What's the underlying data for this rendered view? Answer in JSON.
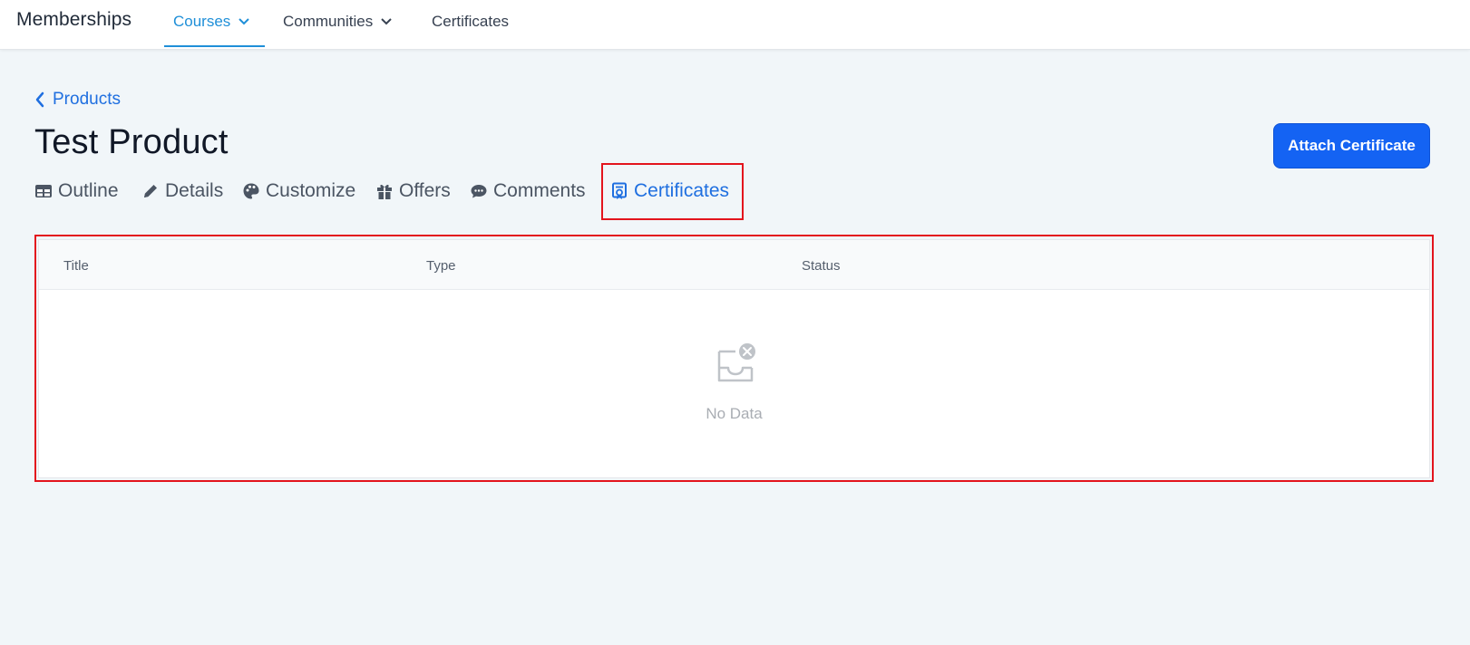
{
  "app": {
    "brand": "Memberships"
  },
  "nav": {
    "items": [
      {
        "label": "Courses",
        "has_dropdown": true,
        "active": true
      },
      {
        "label": "Communities",
        "has_dropdown": true,
        "active": false
      },
      {
        "label": "Certificates",
        "has_dropdown": false,
        "active": false
      }
    ]
  },
  "breadcrumb": {
    "back_label": "Products"
  },
  "page": {
    "title": "Test Product",
    "attach_button_label": "Attach Certificate"
  },
  "tabs": [
    {
      "label": "Outline",
      "icon": "table-icon",
      "active": false
    },
    {
      "label": "Details",
      "icon": "pencil-icon",
      "active": false
    },
    {
      "label": "Customize",
      "icon": "palette-icon",
      "active": false
    },
    {
      "label": "Offers",
      "icon": "gift-icon",
      "active": false
    },
    {
      "label": "Comments",
      "icon": "comment-icon",
      "active": false
    },
    {
      "label": "Certificates",
      "icon": "certificate-icon",
      "active": true
    }
  ],
  "table": {
    "columns": [
      "Title",
      "Type",
      "Status"
    ],
    "rows": [],
    "empty_text": "No Data"
  },
  "colors": {
    "accent": "#1f6fe0",
    "nav_active": "#1f8fd8",
    "primary_button": "#1463f3",
    "highlight": "#e3141d",
    "background": "#f1f6f9"
  }
}
